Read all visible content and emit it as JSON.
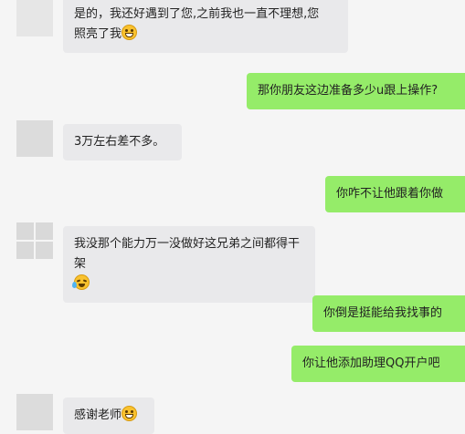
{
  "messages": [
    {
      "side": "in",
      "text": "是的，我还好遇到了您,之前我也一直不理想,您",
      "text2": "照亮了我",
      "emoji": "grinning-face-emoji"
    },
    {
      "side": "out",
      "text": "那你朋友这边准备多少u跟上操作?"
    },
    {
      "side": "in",
      "text": "3万左右差不多。"
    },
    {
      "side": "out",
      "text": "你咋不让他跟着你做"
    },
    {
      "side": "in",
      "text": "我没那个能力万一没做好这兄弟之间都得干架",
      "emoji": "crying-laughing-emoji"
    },
    {
      "side": "out",
      "text": "你倒是挺能给我找事的"
    },
    {
      "side": "out",
      "text": "你让他添加助理QQ开户吧"
    },
    {
      "side": "in",
      "text": "感谢老师",
      "emoji": "grinning-face-emoji"
    }
  ],
  "colors": {
    "background": "#f5f5f5",
    "incoming_bubble": "#e9e9eb",
    "outgoing_bubble": "#95ec69"
  }
}
